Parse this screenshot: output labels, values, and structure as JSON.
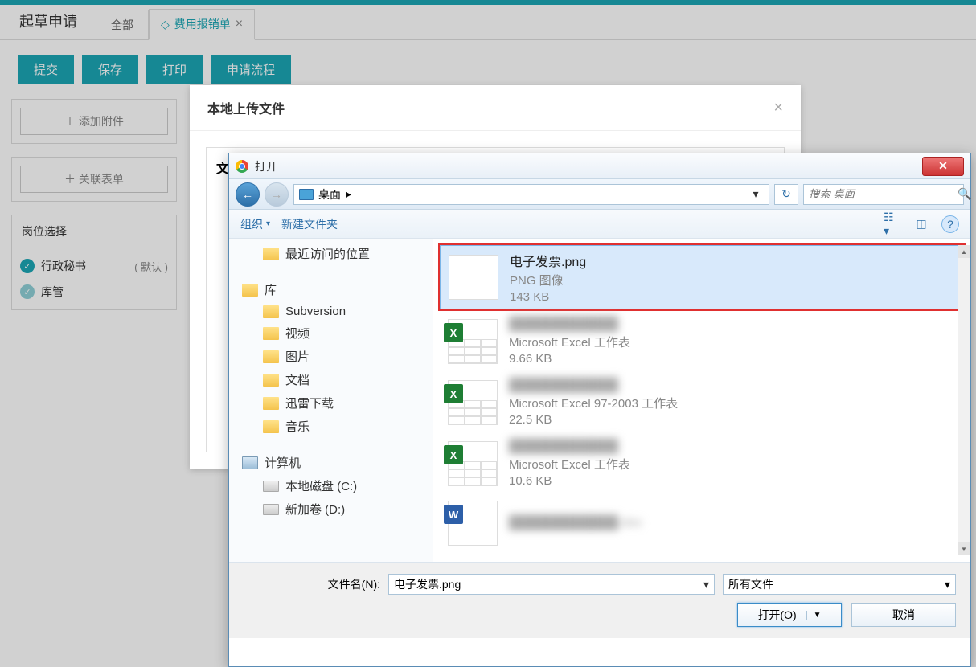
{
  "tabs": {
    "title": "起草申请",
    "sub": "全部",
    "active": "费用报销单"
  },
  "buttons": {
    "submit": "提交",
    "save": "保存",
    "print": "打印",
    "flow": "申请流程"
  },
  "left": {
    "add_attach": "＋ 添加附件",
    "link_form": "＋ 关联表单",
    "role_header": "岗位选择",
    "role1": "行政秘书",
    "default": "( 默认 )",
    "role2": "库管"
  },
  "right": {
    "title_fragment": "销单"
  },
  "modal": {
    "title": "本地上传文件",
    "inner": "文"
  },
  "dlg": {
    "title": "打开",
    "path": "桌面",
    "path_arrow": "▸",
    "search_placeholder": "搜索 桌面",
    "toolbar": {
      "org": "组织",
      "newfolder": "新建文件夹"
    },
    "tree": {
      "recent": "最近访问的位置",
      "lib": "库",
      "svn": "Subversion",
      "video": "视频",
      "pic": "图片",
      "doc": "文档",
      "xunlei": "迅雷下载",
      "music": "音乐",
      "computer": "计算机",
      "cdrive": "本地磁盘 (C:)",
      "ddrive": "新加卷 (D:)"
    },
    "files": [
      {
        "name": "电子发票.png",
        "type": "PNG 图像",
        "size": "143 KB",
        "kind": "png",
        "selected": true
      },
      {
        "name": "████████████",
        "type": "Microsoft Excel 工作表",
        "size": "9.66 KB",
        "kind": "xls"
      },
      {
        "name": "████████████",
        "type": "Microsoft Excel 97-2003 工作表",
        "size": "22.5 KB",
        "kind": "xls"
      },
      {
        "name": "████████████",
        "type": "Microsoft Excel 工作表",
        "size": "10.6 KB",
        "kind": "xls"
      },
      {
        "name": "████████████.doc",
        "type": "",
        "size": "",
        "kind": "doc"
      }
    ],
    "footer": {
      "fname_label": "文件名(N):",
      "fname_value": "电子发票.png",
      "filter": "所有文件",
      "open": "打开(O)",
      "cancel": "取消"
    }
  }
}
